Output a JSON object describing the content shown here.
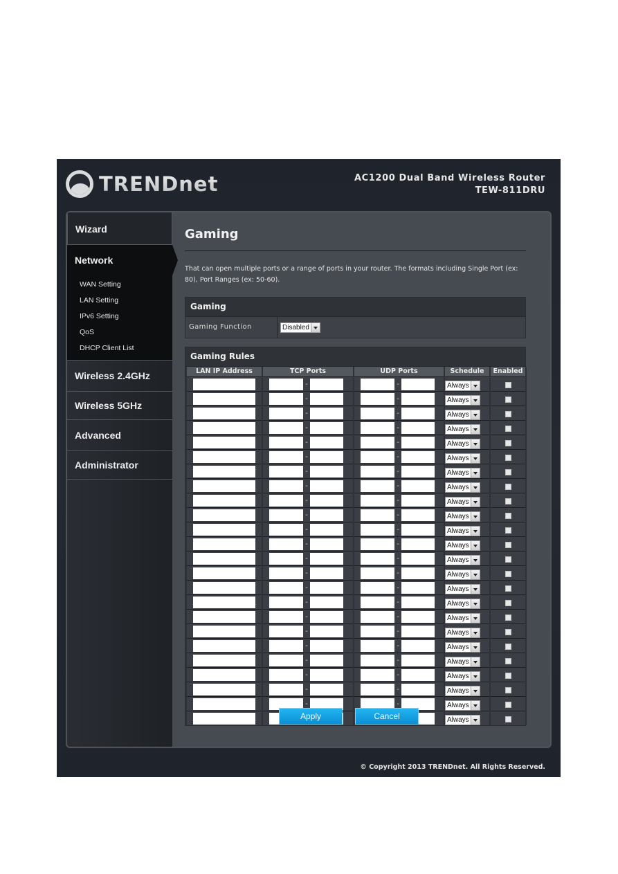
{
  "header": {
    "brand": "TRENDnet",
    "product_line": "AC1200 Dual Band Wireless Router",
    "model": "TEW-811DRU"
  },
  "sidebar": {
    "items": [
      {
        "label": "Wizard",
        "active": false
      },
      {
        "label": "Network",
        "active": true,
        "children": [
          {
            "label": "WAN Setting"
          },
          {
            "label": "LAN Setting"
          },
          {
            "label": "IPv6 Setting"
          },
          {
            "label": "QoS"
          },
          {
            "label": "DHCP Client List"
          }
        ]
      },
      {
        "label": "Wireless 2.4GHz",
        "active": false
      },
      {
        "label": "Wireless 5GHz",
        "active": false
      },
      {
        "label": "Advanced",
        "active": false
      },
      {
        "label": "Administrator",
        "active": false
      }
    ]
  },
  "main": {
    "title": "Gaming",
    "description": "That can open multiple ports or a range of ports in your router. The formats including Single Port (ex: 80), Port Ranges (ex: 50-60).",
    "gaming_section": {
      "header": "Gaming",
      "function_label": "Gaming Function",
      "function_value": "Disabled"
    },
    "rules_section": {
      "header": "Gaming Rules",
      "columns": [
        "LAN IP Address",
        "TCP Ports",
        "UDP Ports",
        "Schedule",
        "Enabled"
      ],
      "port_separator": "-",
      "row_count": 24,
      "rows": [
        {
          "lan_ip": "",
          "tcp_start": "",
          "tcp_end": "",
          "udp_start": "",
          "udp_end": "",
          "schedule": "Always",
          "enabled": false
        },
        {
          "lan_ip": "",
          "tcp_start": "",
          "tcp_end": "",
          "udp_start": "",
          "udp_end": "",
          "schedule": "Always",
          "enabled": false
        },
        {
          "lan_ip": "",
          "tcp_start": "",
          "tcp_end": "",
          "udp_start": "",
          "udp_end": "",
          "schedule": "Always",
          "enabled": false
        },
        {
          "lan_ip": "",
          "tcp_start": "",
          "tcp_end": "",
          "udp_start": "",
          "udp_end": "",
          "schedule": "Always",
          "enabled": false
        },
        {
          "lan_ip": "",
          "tcp_start": "",
          "tcp_end": "",
          "udp_start": "",
          "udp_end": "",
          "schedule": "Always",
          "enabled": false
        },
        {
          "lan_ip": "",
          "tcp_start": "",
          "tcp_end": "",
          "udp_start": "",
          "udp_end": "",
          "schedule": "Always",
          "enabled": false
        },
        {
          "lan_ip": "",
          "tcp_start": "",
          "tcp_end": "",
          "udp_start": "",
          "udp_end": "",
          "schedule": "Always",
          "enabled": false
        },
        {
          "lan_ip": "",
          "tcp_start": "",
          "tcp_end": "",
          "udp_start": "",
          "udp_end": "",
          "schedule": "Always",
          "enabled": false
        },
        {
          "lan_ip": "",
          "tcp_start": "",
          "tcp_end": "",
          "udp_start": "",
          "udp_end": "",
          "schedule": "Always",
          "enabled": false
        },
        {
          "lan_ip": "",
          "tcp_start": "",
          "tcp_end": "",
          "udp_start": "",
          "udp_end": "",
          "schedule": "Always",
          "enabled": false
        },
        {
          "lan_ip": "",
          "tcp_start": "",
          "tcp_end": "",
          "udp_start": "",
          "udp_end": "",
          "schedule": "Always",
          "enabled": false
        },
        {
          "lan_ip": "",
          "tcp_start": "",
          "tcp_end": "",
          "udp_start": "",
          "udp_end": "",
          "schedule": "Always",
          "enabled": false
        },
        {
          "lan_ip": "",
          "tcp_start": "",
          "tcp_end": "",
          "udp_start": "",
          "udp_end": "",
          "schedule": "Always",
          "enabled": false
        },
        {
          "lan_ip": "",
          "tcp_start": "",
          "tcp_end": "",
          "udp_start": "",
          "udp_end": "",
          "schedule": "Always",
          "enabled": false
        },
        {
          "lan_ip": "",
          "tcp_start": "",
          "tcp_end": "",
          "udp_start": "",
          "udp_end": "",
          "schedule": "Always",
          "enabled": false
        },
        {
          "lan_ip": "",
          "tcp_start": "",
          "tcp_end": "",
          "udp_start": "",
          "udp_end": "",
          "schedule": "Always",
          "enabled": false
        },
        {
          "lan_ip": "",
          "tcp_start": "",
          "tcp_end": "",
          "udp_start": "",
          "udp_end": "",
          "schedule": "Always",
          "enabled": false
        },
        {
          "lan_ip": "",
          "tcp_start": "",
          "tcp_end": "",
          "udp_start": "",
          "udp_end": "",
          "schedule": "Always",
          "enabled": false
        },
        {
          "lan_ip": "",
          "tcp_start": "",
          "tcp_end": "",
          "udp_start": "",
          "udp_end": "",
          "schedule": "Always",
          "enabled": false
        },
        {
          "lan_ip": "",
          "tcp_start": "",
          "tcp_end": "",
          "udp_start": "",
          "udp_end": "",
          "schedule": "Always",
          "enabled": false
        },
        {
          "lan_ip": "",
          "tcp_start": "",
          "tcp_end": "",
          "udp_start": "",
          "udp_end": "",
          "schedule": "Always",
          "enabled": false
        },
        {
          "lan_ip": "",
          "tcp_start": "",
          "tcp_end": "",
          "udp_start": "",
          "udp_end": "",
          "schedule": "Always",
          "enabled": false
        },
        {
          "lan_ip": "",
          "tcp_start": "",
          "tcp_end": "",
          "udp_start": "",
          "udp_end": "",
          "schedule": "Always",
          "enabled": false
        },
        {
          "lan_ip": "",
          "tcp_start": "",
          "tcp_end": "",
          "udp_start": "",
          "udp_end": "",
          "schedule": "Always",
          "enabled": false
        }
      ]
    },
    "buttons": {
      "apply": "Apply",
      "cancel": "Cancel"
    }
  },
  "footer": {
    "copyright": "© Copyright 2013 TRENDnet. All Rights Reserved."
  },
  "colors": {
    "page_background": "#22262e",
    "content_panel": "#464a51",
    "button_blue": "#0a9be0",
    "active_nav": "#0d0e10"
  }
}
